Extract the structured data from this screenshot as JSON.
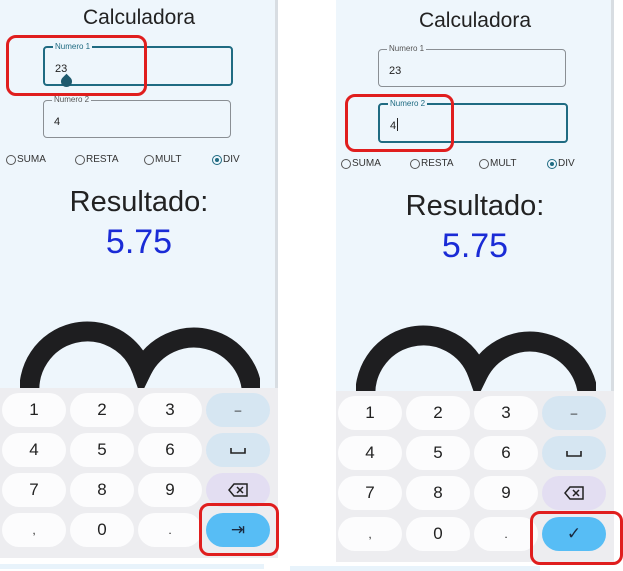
{
  "app": {
    "title": "Calculadora"
  },
  "colors": {
    "accent": "#1f6b82",
    "result": "#1a2bd6",
    "highlight": "#e01e1e",
    "action_key": "#57bdf5"
  },
  "panels": [
    {
      "numero1": {
        "label": "Numero 1",
        "value": "23"
      },
      "numero2": {
        "label": "Numero 2",
        "value": "4"
      },
      "focused_field": "numero1",
      "radios": [
        {
          "label": "SUMA",
          "checked": false
        },
        {
          "label": "RESTA",
          "checked": false
        },
        {
          "label": "MULT",
          "checked": false
        },
        {
          "label": "DIV",
          "checked": true
        }
      ],
      "result_label": "Resultado:",
      "result_value": "5.75",
      "keys": {
        "k1": "1",
        "k2": "2",
        "k3": "3",
        "minus": "–",
        "k4": "4",
        "k5": "5",
        "k6": "6",
        "k7": "7",
        "k8": "8",
        "k9": "9",
        "comma": ",",
        "k0": "0",
        "dot": ".",
        "action": "⇥",
        "backspace_icon": "backspace-icon",
        "space_icon": "space-icon"
      }
    },
    {
      "numero1": {
        "label": "Numero 1",
        "value": "23"
      },
      "numero2": {
        "label": "Numero 2",
        "value": "4"
      },
      "focused_field": "numero2",
      "radios": [
        {
          "label": "SUMA",
          "checked": false
        },
        {
          "label": "RESTA",
          "checked": false
        },
        {
          "label": "MULT",
          "checked": false
        },
        {
          "label": "DIV",
          "checked": true
        }
      ],
      "result_label": "Resultado:",
      "result_value": "5.75",
      "keys": {
        "k1": "1",
        "k2": "2",
        "k3": "3",
        "minus": "–",
        "k4": "4",
        "k5": "5",
        "k6": "6",
        "k7": "7",
        "k8": "8",
        "k9": "9",
        "comma": ",",
        "k0": "0",
        "dot": ".",
        "action": "✓",
        "backspace_icon": "backspace-icon",
        "space_icon": "space-icon"
      }
    }
  ]
}
